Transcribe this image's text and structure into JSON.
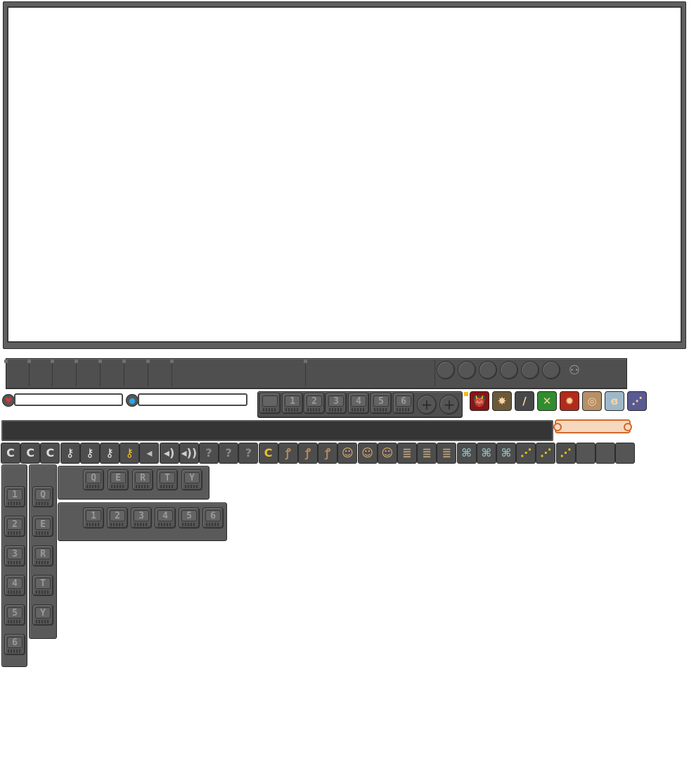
{
  "ui": {
    "skill_bar": {
      "slot_labels": [
        "1",
        "2",
        "3",
        "4",
        "5",
        "6"
      ]
    },
    "action_icons": [
      {
        "name": "demon",
        "glyph": "👹",
        "bg": "#8a1414"
      },
      {
        "name": "star-burst",
        "glyph": "✸",
        "bg": "#6a5a3a"
      },
      {
        "name": "feather",
        "glyph": "/",
        "bg": "#474747"
      },
      {
        "name": "cross",
        "glyph": "✕",
        "bg": "#2f8d2f"
      },
      {
        "name": "flame",
        "glyph": "✹",
        "bg": "#b22a1a"
      },
      {
        "name": "aura",
        "glyph": "◎",
        "bg": "#b59068"
      },
      {
        "name": "whirlwind",
        "glyph": "ɞ",
        "bg": "#9fb8c9"
      },
      {
        "name": "signal",
        "glyph": "⋰",
        "bg": "#5a5a92"
      }
    ],
    "toolbar_glyphs": [
      "C",
      "C",
      "C",
      "⚷",
      "⚷",
      "⚷",
      "⚷",
      "◂",
      "◂)",
      "◂))",
      "?",
      "?",
      "?",
      "C",
      "ꝭ",
      "ꝭ",
      "ꝭ",
      "☺",
      "☺",
      "☺",
      "≣",
      "≣",
      "≣",
      "⌘",
      "⌘",
      "⌘",
      "⋰",
      "⋰",
      "⋰",
      "",
      "",
      ""
    ],
    "toolbar_colors": [
      "#dcdcdc",
      "#dcdcdc",
      "#dcdcdc",
      "#e6e6e6",
      "#e6e6e6",
      "#e6e6e6",
      "#f0c020",
      "#bdbdbd",
      "#cfcfcf",
      "#cfcfcf",
      "#8a8a8a",
      "#8a8a8a",
      "#8a8a8a",
      "#f0c020",
      "#b98a5a",
      "#b98a5a",
      "#b98a5a",
      "#e2b070",
      "#e2b070",
      "#e2b070",
      "#b9a27d",
      "#b9a27d",
      "#b9a27d",
      "#8eb2b2",
      "#8eb2b2",
      "#8eb2b2",
      "#e6c020",
      "#e6c020",
      "#e6c020",
      "#555555",
      "#555555",
      "#555555"
    ],
    "qwerty_keys": [
      "Q",
      "E",
      "R",
      "T",
      "Y"
    ],
    "number_keys": [
      "1",
      "2",
      "3",
      "4",
      "5",
      "6"
    ],
    "health_icon": "heart-icon",
    "mana_icon": "mana-orb-icon"
  }
}
